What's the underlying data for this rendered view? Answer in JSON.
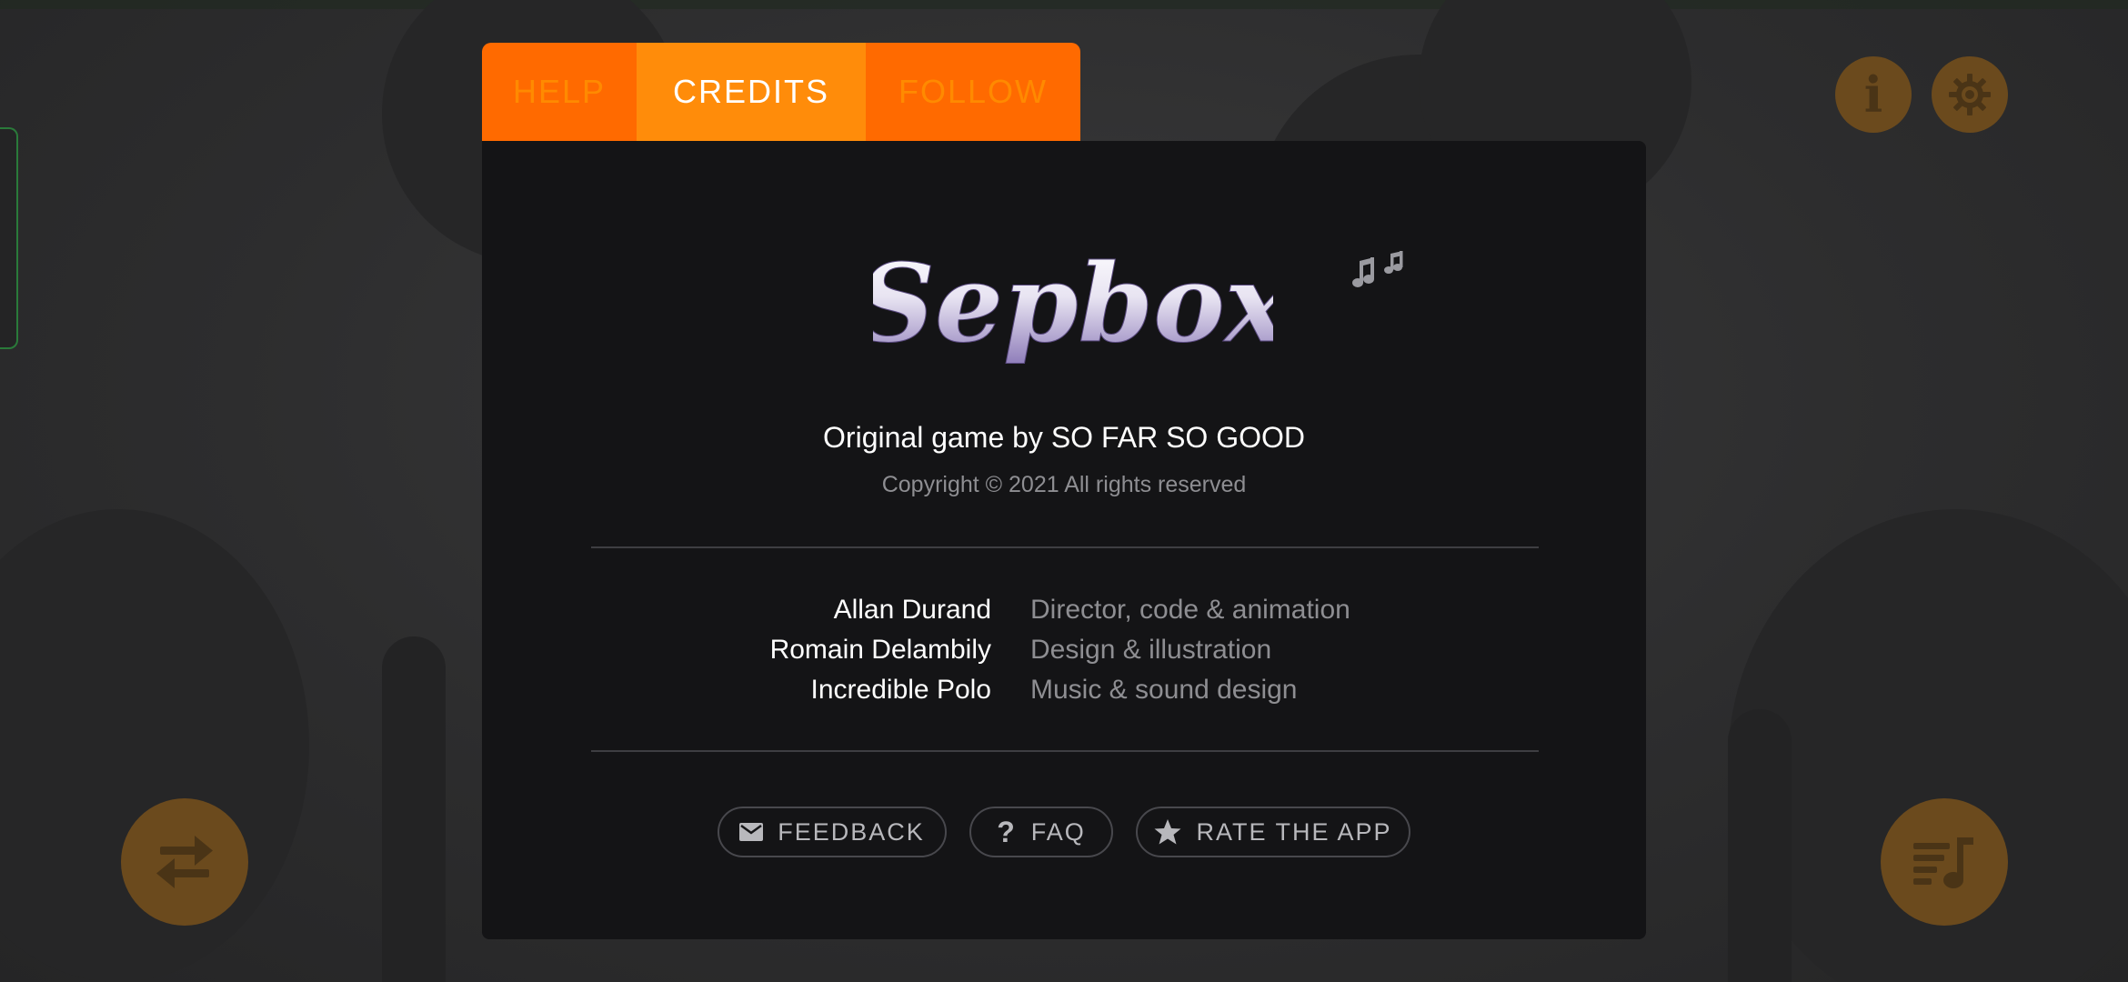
{
  "tabs": [
    {
      "label": "HELP"
    },
    {
      "label": "CREDITS"
    },
    {
      "label": "FOLLOW"
    }
  ],
  "active_tab": "CREDITS",
  "logo": {
    "text": "Sepbox"
  },
  "credits": {
    "original": "Original game by SO FAR SO GOOD",
    "copyright": "Copyright © 2021 All rights reserved",
    "people": [
      {
        "name": "Allan Durand",
        "role": "Director, code & animation"
      },
      {
        "name": "Romain Delambily",
        "role": "Design & illustration"
      },
      {
        "name": "Incredible Polo",
        "role": "Music & sound design"
      }
    ]
  },
  "buttons": {
    "feedback": "FEEDBACK",
    "faq": "FAQ",
    "rate": "RATE THE APP"
  },
  "icons": {
    "info": "info-icon",
    "settings": "gear-icon",
    "swap": "swap-arrows-icon",
    "playlist": "playlist-music-icon",
    "feedback": "envelope-icon",
    "faq": "question-mark-icon",
    "rate": "star-icon",
    "notes": "music-notes-icon"
  },
  "colors": {
    "tab_bar": "#ff6a00",
    "tab_active": "#ff8c0a",
    "tab_inactive_text": "#ff8a00",
    "panel": "#141416",
    "round_button": "#6b4a1d",
    "logo_top": "#ffffff",
    "logo_bottom": "#8c7ab8"
  }
}
